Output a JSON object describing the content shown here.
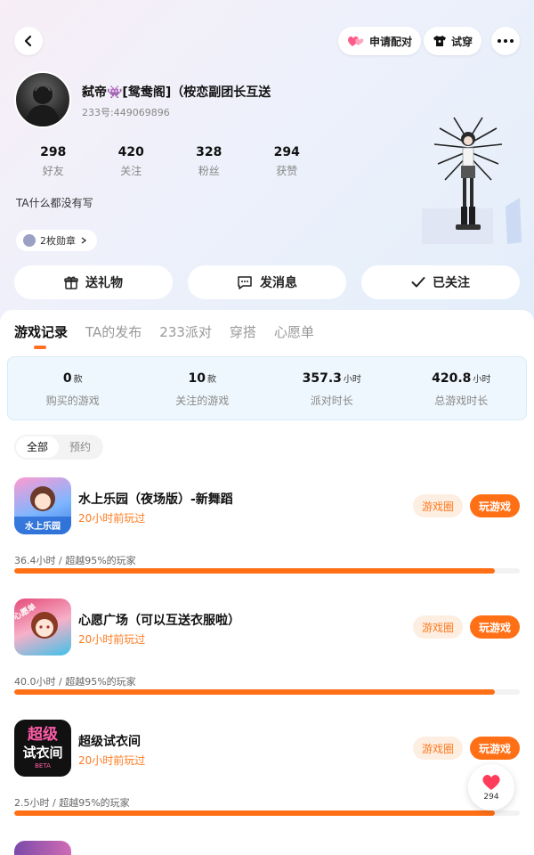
{
  "header": {
    "pair_label": "申请配对",
    "try_label": "试穿"
  },
  "profile": {
    "nickname": "弑帝👾[鸳鸯阁]（桉恋副团长互送",
    "uid": "233号:449069896",
    "bio": "TA什么都没有写",
    "badge_label": "2枚勋章",
    "stats": [
      {
        "num": "298",
        "label": "好友"
      },
      {
        "num": "420",
        "label": "关注"
      },
      {
        "num": "328",
        "label": "粉丝"
      },
      {
        "num": "294",
        "label": "获赞"
      }
    ]
  },
  "actions": {
    "gift": "送礼物",
    "message": "发消息",
    "followed": "已关注"
  },
  "tabs": [
    "游戏记录",
    "TA的发布",
    "233派对",
    "穿搭",
    "心愿单"
  ],
  "summary": [
    {
      "value": "0",
      "unit": "款",
      "label": "购买的游戏"
    },
    {
      "value": "10",
      "unit": "款",
      "label": "关注的游戏"
    },
    {
      "value": "357.3",
      "unit": "小时",
      "label": "派对时长"
    },
    {
      "value": "420.8",
      "unit": "小时",
      "label": "总游戏时长"
    }
  ],
  "filters": [
    "全部",
    "预约"
  ],
  "games": [
    {
      "name": "水上乐园（夜场版）-新舞蹈",
      "played": "20小时前玩过",
      "circle": "游戏圈",
      "play": "玩游戏",
      "meta": "36.4小时 / 超越95%的玩家",
      "progress": 0.95
    },
    {
      "name": "心愿广场（可以互送衣服啦）",
      "played": "20小时前玩过",
      "circle": "游戏圈",
      "play": "玩游戏",
      "meta": "40.0小时 / 超越95%的玩家",
      "progress": 0.95
    },
    {
      "name": "超级试衣间",
      "played": "20小时前玩过",
      "circle": "游戏圈",
      "play": "玩游戏",
      "meta": "2.5小时 / 超越95%的玩家",
      "progress": 0.95
    }
  ],
  "game_icon_text": {
    "icon1": "水上乐园",
    "icon2": "心愿单",
    "icon3_line1": "超级",
    "icon3_line2": "试衣间",
    "icon3_tag": "BETA"
  },
  "like_count": "294",
  "colors": {
    "accent": "#ff7016",
    "accent_light": "#fdeee2"
  }
}
